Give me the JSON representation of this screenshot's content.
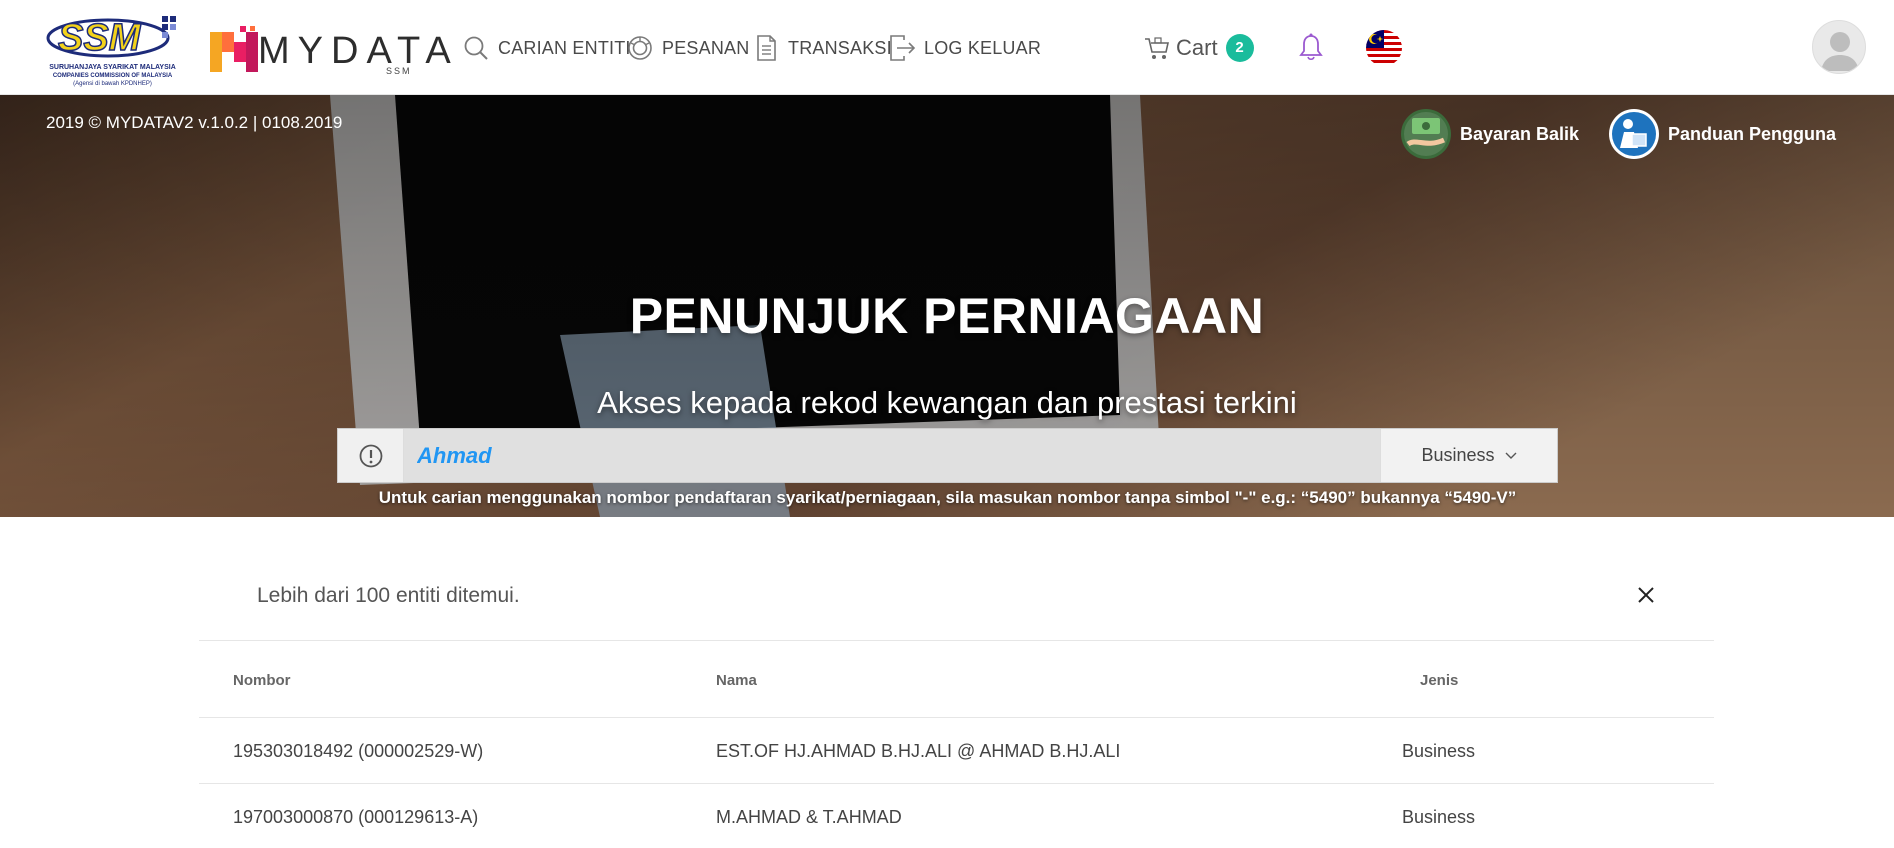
{
  "header": {
    "ssm_logo_text": "SSM",
    "ssm_subtitle_1": "SURUHANJAYA SYARIKAT MALAYSIA",
    "ssm_subtitle_2": "COMPANIES COMMISSION OF MALAYSIA",
    "ssm_subtitle_3": "(Agensi di bawah KPDNHEP)",
    "mydata_logo": "MYDATA",
    "mydata_logo_sub": "SSM",
    "nav": [
      {
        "label": "CARIAN ENTITI",
        "icon": "search-icon"
      },
      {
        "label": "PESANAN",
        "icon": "orders-icon"
      },
      {
        "label": "TRANSAKSI",
        "icon": "document-icon"
      },
      {
        "label": "LOG KELUAR",
        "icon": "logout-icon"
      }
    ],
    "cart_label": "Cart",
    "cart_count": "2",
    "notification_icon": "bell-icon",
    "language_icon": "malaysia-flag-icon",
    "avatar_icon": "user-avatar-icon"
  },
  "hero": {
    "version_text": "2019 © MYDATAV2 v.1.0.2   |  0108.2019",
    "refund_label": "Bayaran Balik",
    "guide_label": "Panduan Pengguna",
    "title": "PENUNJUK PERNIAGAAN",
    "subtitle": "Akses kepada rekod kewangan dan prestasi terkini",
    "search": {
      "value": "Ahmad",
      "placeholder": "",
      "type_selected": "Business"
    },
    "hint": "Untuk carian menggunakan nombor pendaftaran syarikat/perniagaan, sila masukan nombor tanpa simbol \"-\" e.g.: “5490” bukannya “5490-V”"
  },
  "results": {
    "count_text": "Lebih dari 100 entiti ditemui.",
    "columns": [
      "Nombor",
      "Nama",
      "Jenis"
    ],
    "rows": [
      {
        "nombor": "195303018492 (000002529-W)",
        "nama": "EST.OF HJ.AHMAD B.HJ.ALI @ AHMAD B.HJ.ALI",
        "jenis": "Business"
      },
      {
        "nombor": "197003000870 (000129613-A)",
        "nama": "M.AHMAD & T.AHMAD",
        "jenis": "Business"
      }
    ]
  },
  "colors": {
    "accent": "#1abc9c",
    "search_text": "#2196f3",
    "bell": "#9b59d0"
  }
}
